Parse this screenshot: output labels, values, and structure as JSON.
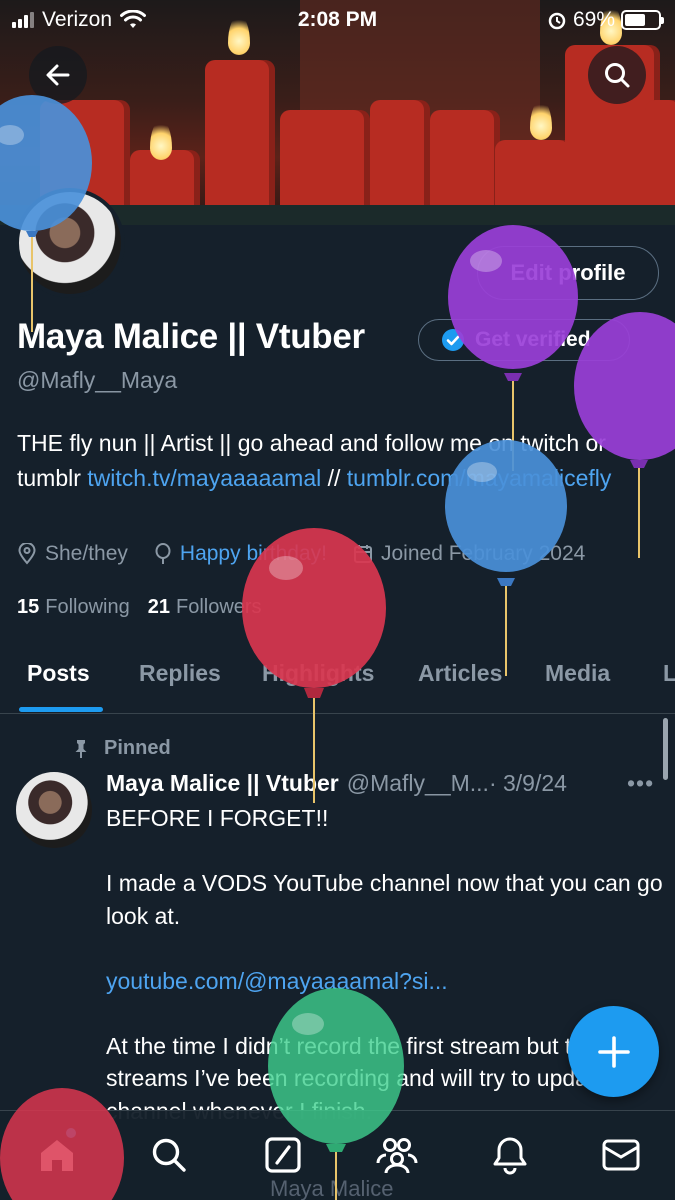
{
  "status_bar": {
    "carrier": "Verizon",
    "time": "2:08 PM",
    "battery": "69%"
  },
  "header": {
    "back_icon": "arrow-left-icon",
    "search_icon": "search-icon"
  },
  "profile": {
    "display_name": "Maya Malice || Vtuber",
    "handle": "@Mafly__Maya",
    "edit_label": "Edit profile",
    "verify_label": "Get verified",
    "bio_text": "THE fly nun || Artist || go ahead and follow me on twitch or tumblr ",
    "bio_link1": "twitch.tv/mayaaaaamal",
    "bio_sep": " // ",
    "bio_link2": "tumblr.com/mayamalicefly",
    "pronouns": "She/they",
    "birthday": "Happy birthday!",
    "joined": "Joined February 2024",
    "following_count": "15",
    "following_label": "Following",
    "followers_count": "21",
    "followers_label": "Followers"
  },
  "tabs": [
    "Posts",
    "Replies",
    "Highlights",
    "Articles",
    "Media",
    "L"
  ],
  "post": {
    "pinned_label": "Pinned",
    "author": "Maya Malice || Vtuber",
    "handle": "@Mafly__M...",
    "date": "· 3/9/24",
    "line1": "BEFORE I FORGET!!",
    "line2": "I made a VODS YouTube channel now that you can go look at.",
    "link": "youtube.com/@mayaaaamal?si...",
    "line3": "At the time I didn’t record the first stream but the other streams I’ve been recording and will try to update the channel whenever I finish."
  },
  "nav": [
    "home-icon",
    "search-icon",
    "compose-icon",
    "communities-icon",
    "bell-icon",
    "mail-icon"
  ],
  "quoted_preview": "Maya Malice",
  "colors": {
    "accent": "#1d9bf0",
    "background": "#15202b",
    "link": "#4ea4f0",
    "muted": "#8b98a5"
  }
}
